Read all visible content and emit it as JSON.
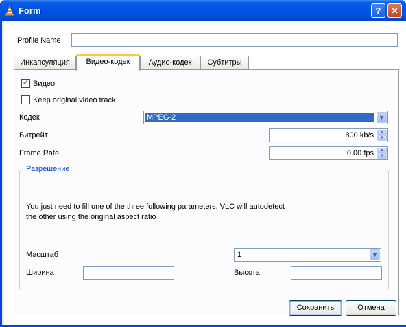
{
  "window": {
    "title": "Form"
  },
  "profile": {
    "label": "Profile Name",
    "value": ""
  },
  "tabs": [
    {
      "label": "Инкапсуляция"
    },
    {
      "label": "Видео-кодек"
    },
    {
      "label": "Аудио-кодек"
    },
    {
      "label": "Субтитры"
    }
  ],
  "video": {
    "enable_label": "Видео",
    "enable_checked": true,
    "keep_label": "Keep original video track",
    "keep_checked": false,
    "codec_label": "Кодек",
    "codec_value": "MPEG-2",
    "bitrate_label": "Битрейт",
    "bitrate_value": "800 kb/s",
    "framerate_label": "Frame Rate",
    "framerate_value": "0.00 fps"
  },
  "resolution": {
    "title": "Разрешение",
    "hint_line1": "You just need to fill one of the three following parameters, VLC will autodetect",
    "hint_line2": "the other using the original aspect ratio",
    "scale_label": "Масштаб",
    "scale_value": "1",
    "width_label": "Ширина",
    "width_value": "",
    "height_label": "Высота",
    "height_value": ""
  },
  "buttons": {
    "save": "Сохранить",
    "cancel": "Отмена"
  },
  "icons": {
    "app": "vlc-cone-icon",
    "help": "help-icon",
    "close": "close-icon"
  },
  "colors": {
    "titlebar": "#0055e5",
    "selection": "#316ac5",
    "group_title": "#0046d5",
    "tab_highlight": "#ffc83c"
  }
}
